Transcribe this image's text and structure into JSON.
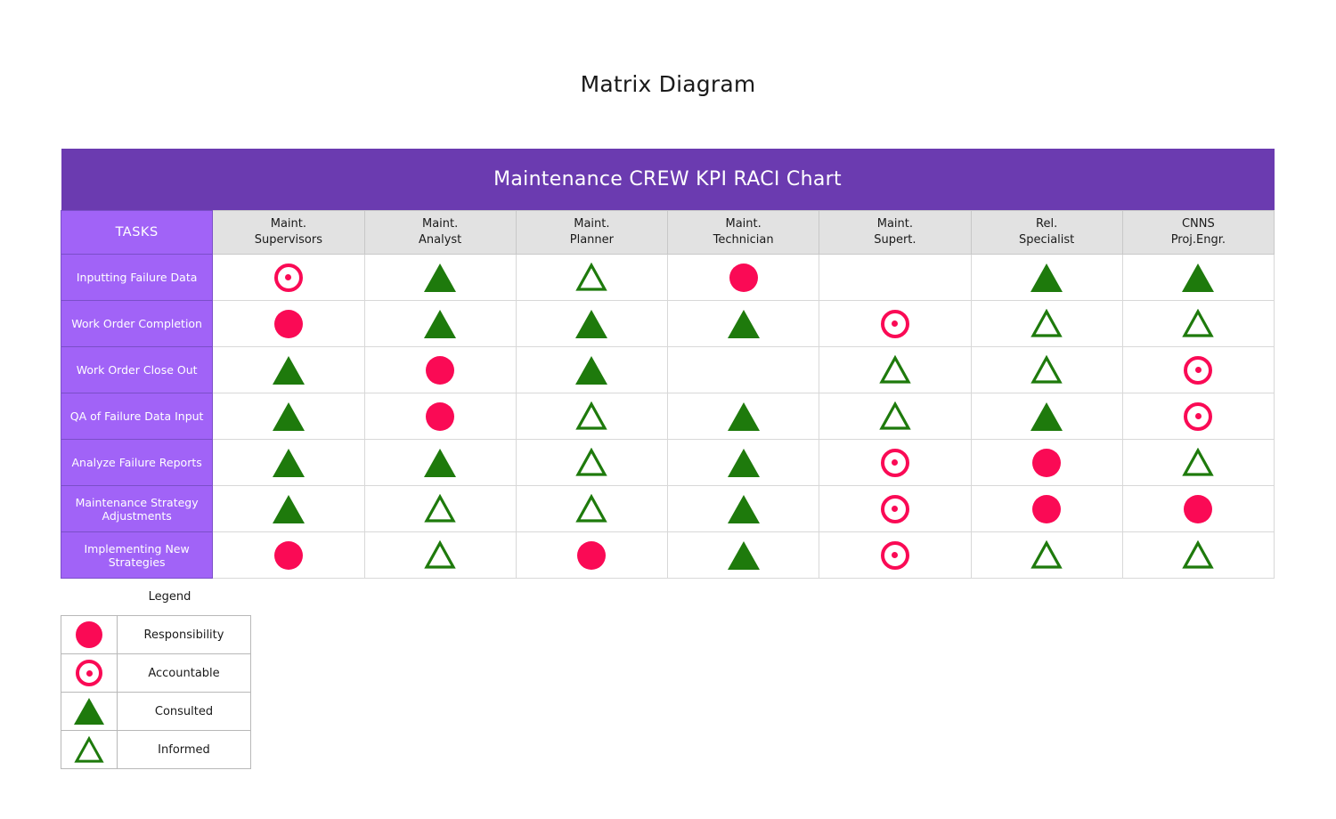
{
  "page": {
    "title": "Matrix Diagram"
  },
  "matrix": {
    "banner_title": "Maintenance CREW KPI RACI Chart",
    "tasks_header": "TASKS",
    "column_headers": [
      {
        "line1": "Maint.",
        "line2": "Supervisors"
      },
      {
        "line1": "Maint.",
        "line2": "Analyst"
      },
      {
        "line1": "Maint.",
        "line2": "Planner"
      },
      {
        "line1": "Maint.",
        "line2": "Technician"
      },
      {
        "line1": "Maint.",
        "line2": "Supert."
      },
      {
        "line1": "Rel.",
        "line2": "Specialist"
      },
      {
        "line1": "CNNS",
        "line2": "Proj.Engr."
      }
    ],
    "rows": [
      {
        "task": "Inputting Failure Data",
        "cells": [
          "A",
          "C",
          "I",
          "R",
          "",
          "C",
          "C"
        ]
      },
      {
        "task": "Work Order Completion",
        "cells": [
          "R",
          "C",
          "C",
          "C",
          "A",
          "I",
          "I"
        ]
      },
      {
        "task": "Work Order Close Out",
        "cells": [
          "C",
          "R",
          "C",
          "",
          "I",
          "I",
          "A"
        ]
      },
      {
        "task": "QA of Failure Data Input",
        "cells": [
          "C",
          "R",
          "I",
          "C",
          "I",
          "C",
          "A"
        ]
      },
      {
        "task": "Analyze Failure Reports",
        "cells": [
          "C",
          "C",
          "I",
          "C",
          "A",
          "R",
          "I"
        ]
      },
      {
        "task": "Maintenance Strategy Adjustments",
        "cells": [
          "C",
          "I",
          "I",
          "C",
          "A",
          "R",
          "R"
        ]
      },
      {
        "task": "Implementing New Strategies",
        "cells": [
          "R",
          "I",
          "R",
          "C",
          "A",
          "I",
          "I"
        ]
      }
    ]
  },
  "legend": {
    "title": "Legend",
    "items": [
      {
        "symbol": "R",
        "label": "Responsibility",
        "icon": "filled-circle-icon"
      },
      {
        "symbol": "A",
        "label": "Accountable",
        "icon": "ring-dot-icon"
      },
      {
        "symbol": "C",
        "label": "Consulted",
        "icon": "filled-triangle-icon"
      },
      {
        "symbol": "I",
        "label": "Informed",
        "icon": "hollow-triangle-icon"
      }
    ]
  },
  "colors": {
    "banner_purple": "#6B3BB0",
    "cell_purple": "#A163F7",
    "header_gray": "#E2E2E2",
    "crimson": "#FA0A55",
    "green": "#1E7A0C",
    "grid_line": "#D8D8D8"
  }
}
